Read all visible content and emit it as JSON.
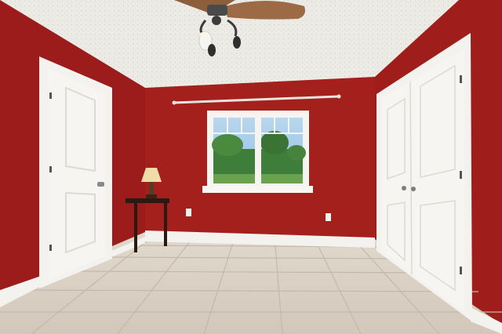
{
  "scene": {
    "kind": "empty bedroom with red walls, white doors, window and ceiling fan",
    "colors": {
      "wall": "#a4201d",
      "wall_shadow": "#8a1715",
      "ceiling": "#ecebe6",
      "floor": "#d9cfc3",
      "floor_grout": "#c4b8aa",
      "trim": "#f4f2ee",
      "door": "#f6f5f2",
      "door_panel_line": "#dcdad4",
      "fan_blade": "#9c6a45",
      "glass_sky": "#9cc6e6",
      "foliage": "#3f7d3a",
      "lamp_shade": "#efdca8"
    },
    "objects": [
      "ceiling-fan",
      "window",
      "curtain-rod",
      "side-table",
      "table-lamp",
      "left-door",
      "closet-double-door",
      "wall-outlet",
      "baseboard",
      "tile-floor"
    ]
  }
}
